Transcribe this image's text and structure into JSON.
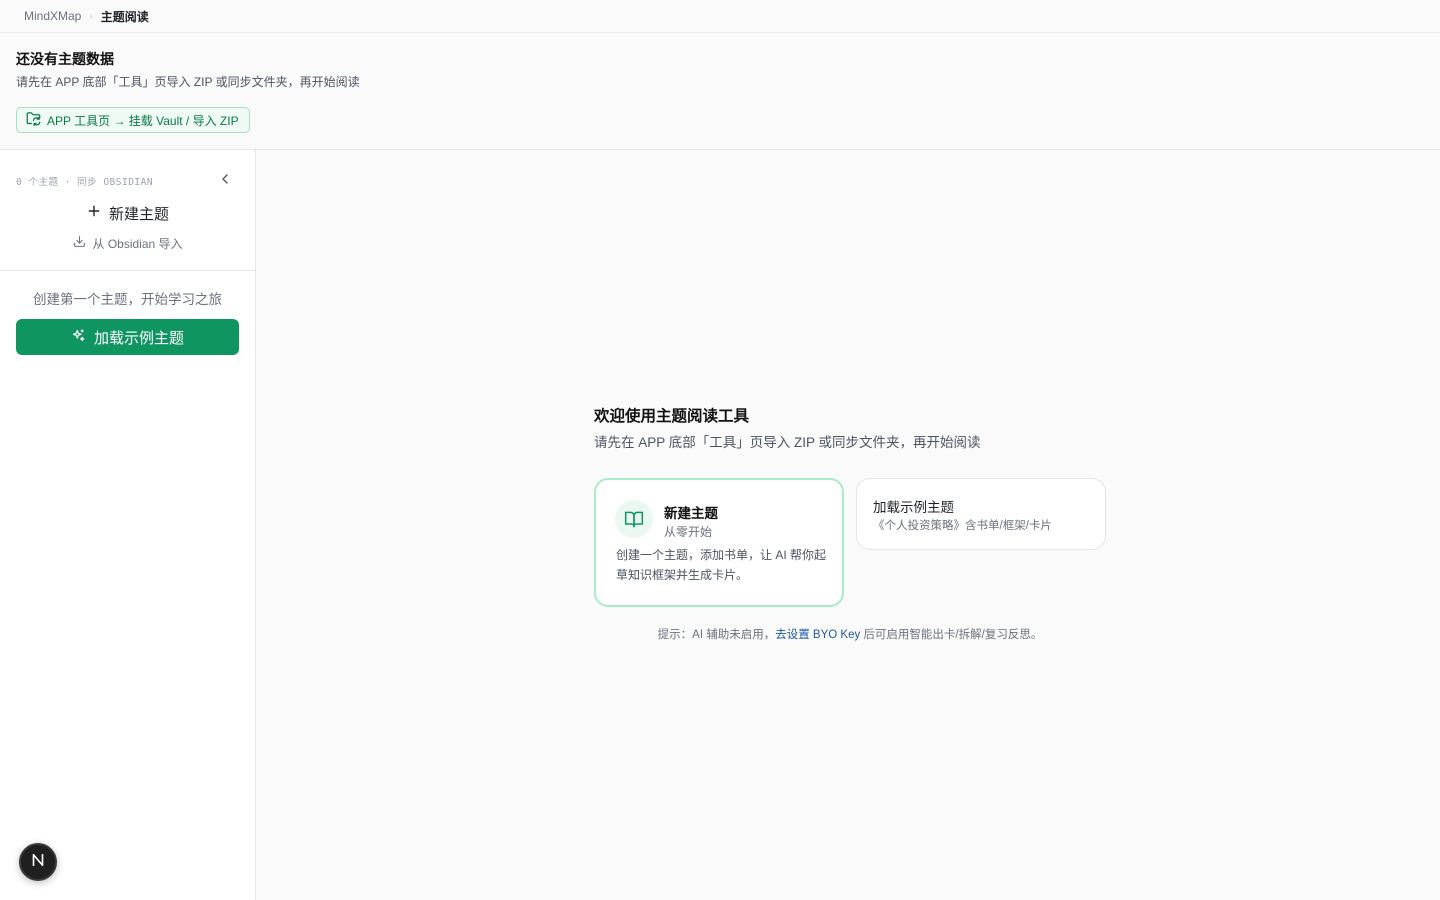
{
  "breadcrumb": {
    "root": "MindXMap",
    "separator": "›",
    "current": "主题阅读"
  },
  "notice": {
    "title": "还没有主题数据",
    "description": "请先在 APP 底部「工具」页导入 ZIP 或同步文件夹，再开始阅读",
    "chip_label": "APP 工具页 → 挂载 Vault / 导入 ZIP",
    "chip_icon": "folder-sync-icon"
  },
  "sidebar": {
    "meta": "0 个主题 · 同步 OBSIDIAN",
    "collapse_icon": "chevron-left-icon",
    "new_topic": "新建主题",
    "import_label": "从 Obsidian 导入",
    "empty_hint": "创建第一个主题，开始学习之旅",
    "load_sample": "加载示例主题"
  },
  "main": {
    "welcome_title": "欢迎使用主题阅读工具",
    "welcome_desc": "请先在 APP 底部「工具」页导入 ZIP 或同步文件夹，再开始阅读",
    "card_new": {
      "title": "新建主题",
      "subtitle": "从零开始",
      "body": "创建一个主题，添加书单，让 AI 帮你起草知识框架并生成卡片。",
      "icon": "open-book-icon"
    },
    "card_sample": {
      "title": "加载示例主题",
      "subtitle": "《个人投资策略》含书单/框架/卡片"
    },
    "tip_prefix": "提示：AI 辅助未启用，",
    "tip_link": "去设置 BYO Key",
    "tip_suffix": " 后可启用智能出卡/拆解/复习反思。"
  },
  "badge": {
    "letter": "N"
  },
  "colors": {
    "accent": "#0f9660",
    "accent_light": "#effaf4",
    "link": "#1e5aa8",
    "card_border": "#a9ecc8"
  }
}
